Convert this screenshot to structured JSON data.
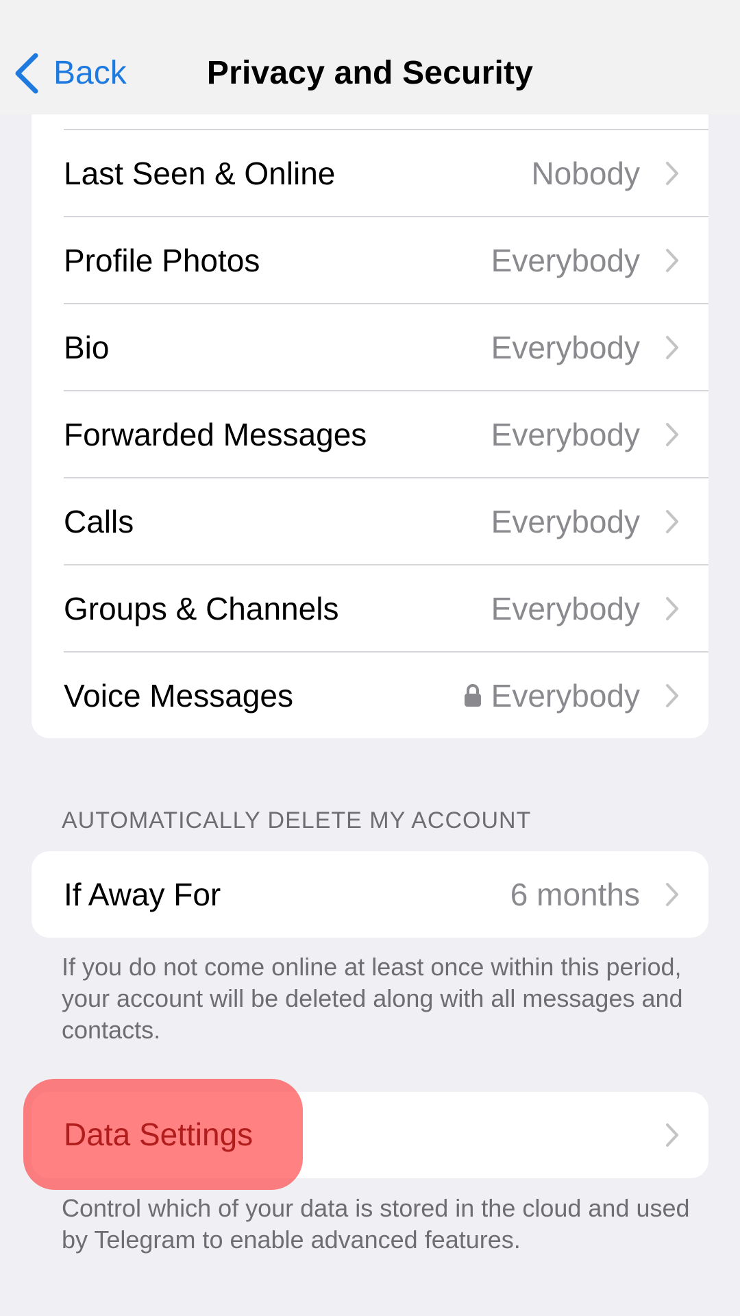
{
  "navbar": {
    "back_label": "Back",
    "title": "Privacy and Security"
  },
  "privacy": {
    "items": [
      {
        "label": "Last Seen & Online",
        "value": "Nobody",
        "locked": false
      },
      {
        "label": "Profile Photos",
        "value": "Everybody",
        "locked": false
      },
      {
        "label": "Bio",
        "value": "Everybody",
        "locked": false
      },
      {
        "label": "Forwarded Messages",
        "value": "Everybody",
        "locked": false
      },
      {
        "label": "Calls",
        "value": "Everybody",
        "locked": false
      },
      {
        "label": "Groups & Channels",
        "value": "Everybody",
        "locked": false
      },
      {
        "label": "Voice Messages",
        "value": "Everybody",
        "locked": true
      }
    ]
  },
  "auto_delete": {
    "header": "AUTOMATICALLY DELETE MY ACCOUNT",
    "row_label": "If Away For",
    "row_value": "6 months",
    "footnote": "If you do not come online at least once within this period, your account will be deleted along with all messages and contacts."
  },
  "data_settings": {
    "label": "Data Settings",
    "footnote": "Control which of your data is stored in the cloud and used by Telegram to enable advanced features."
  },
  "colors": {
    "accent": "#1f7ae0",
    "highlight": "#ff4646",
    "background": "#efeff4",
    "secondary_text": "#8a8a8e"
  },
  "icons": {
    "back": "chevron-left-icon",
    "disclosure": "chevron-right-icon",
    "lock": "lock-icon"
  }
}
